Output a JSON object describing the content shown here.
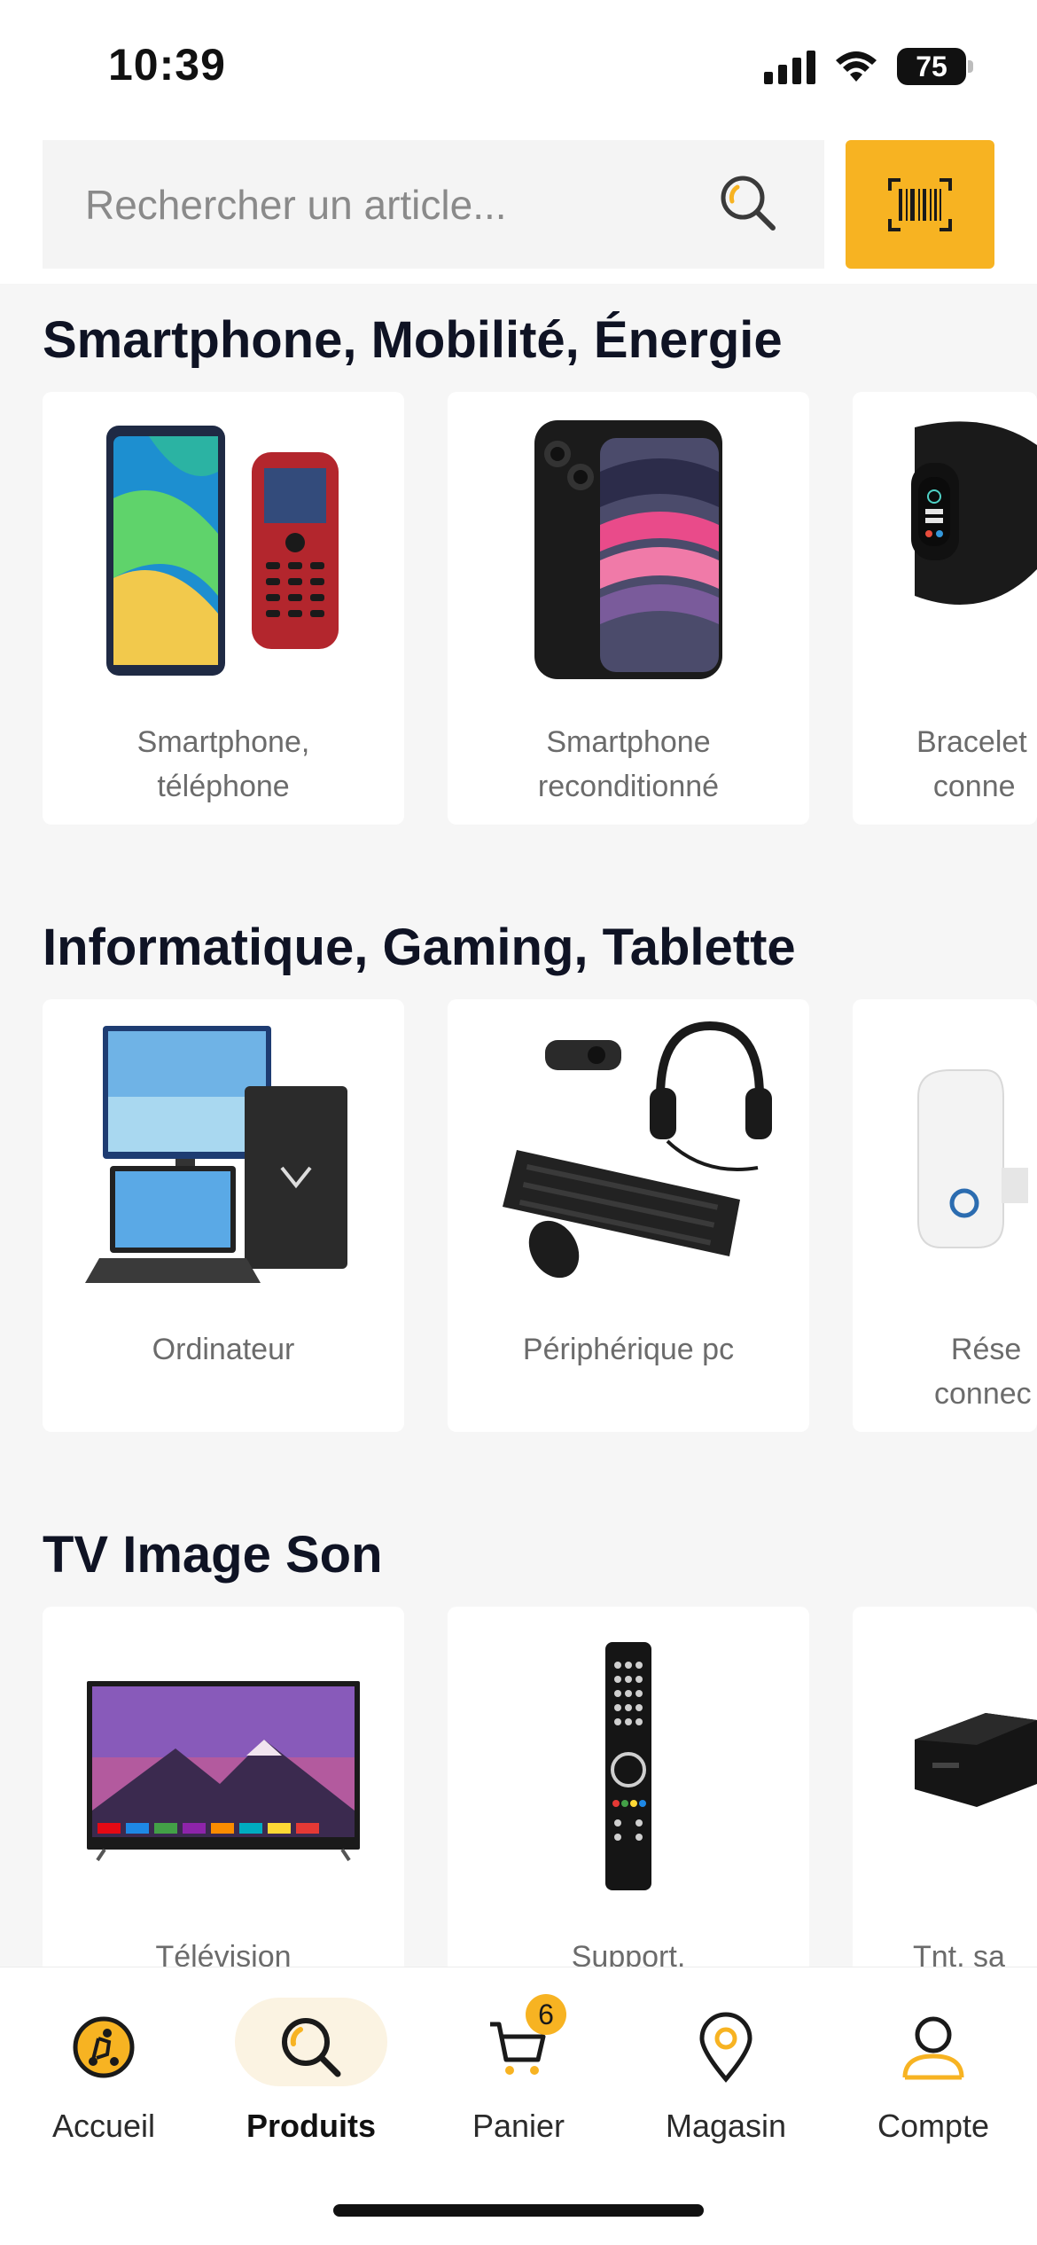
{
  "status_bar": {
    "time": "10:39",
    "battery": "75"
  },
  "search": {
    "placeholder": "Rechercher un article..."
  },
  "sections": [
    {
      "title": "Smartphone, Mobilité, Énergie",
      "cards": [
        {
          "label": "Smartphone,\ntéléphone"
        },
        {
          "label": "Smartphone\nreconditionné"
        },
        {
          "label": "Bracelet\n  conne"
        }
      ]
    },
    {
      "title": "Informatique, Gaming, Tablette",
      "cards": [
        {
          "label": "Ordinateur"
        },
        {
          "label": "Périphérique pc"
        },
        {
          "label": "  Rése\nconnec"
        }
      ]
    },
    {
      "title": "TV Image Son",
      "cards": [
        {
          "label": "Télévision"
        },
        {
          "label": "Support,"
        },
        {
          "label": "Tnt, sa"
        }
      ]
    }
  ],
  "bottom_nav": {
    "items": [
      {
        "label": "Accueil",
        "icon": "home-scooter-icon"
      },
      {
        "label": "Produits",
        "icon": "search-icon",
        "active": true
      },
      {
        "label": "Panier",
        "icon": "cart-icon",
        "badge": "6"
      },
      {
        "label": "Magasin",
        "icon": "location-pin-icon"
      },
      {
        "label": "Compte",
        "icon": "user-icon"
      }
    ]
  },
  "colors": {
    "accent": "#f7b322",
    "background": "#f6f6f6",
    "title": "#0f1324"
  }
}
